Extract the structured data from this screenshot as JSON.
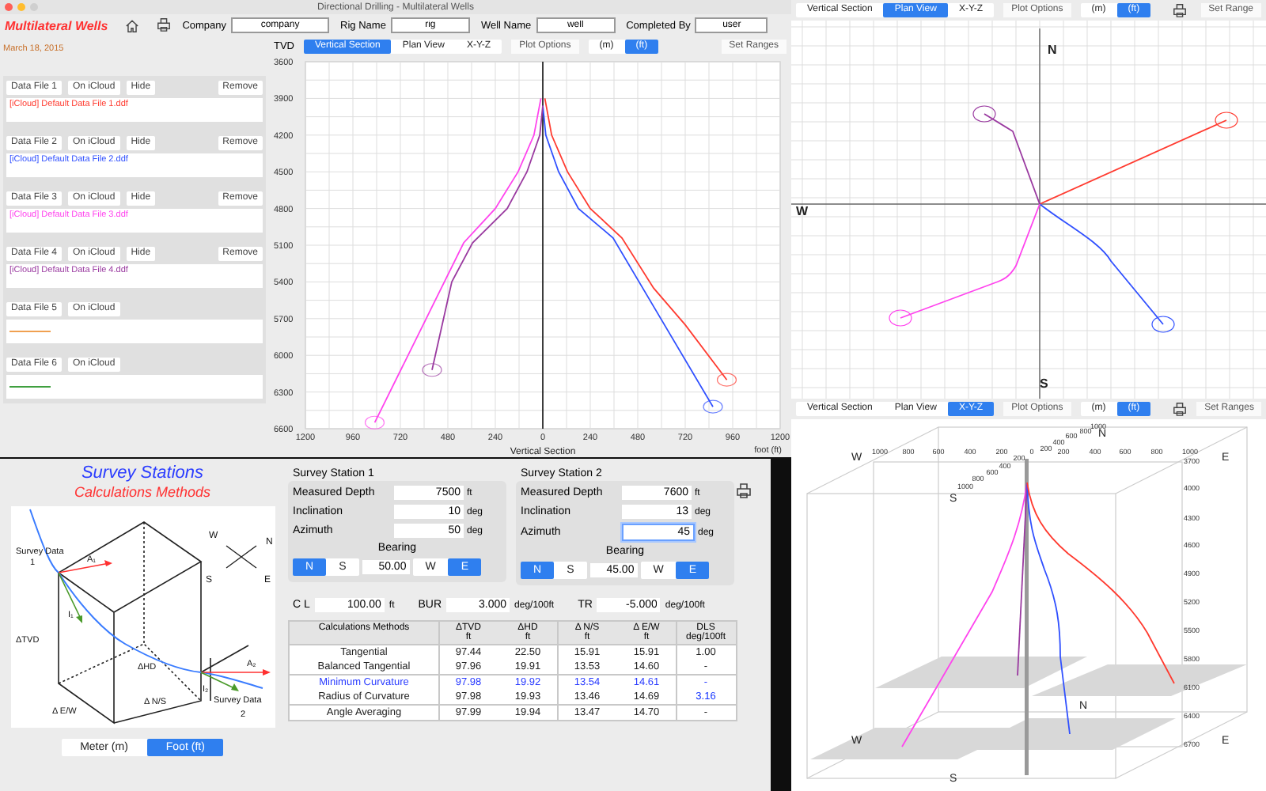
{
  "main_window": {
    "title": "Directional Drilling - Multilateral Wells",
    "app_title": "Multilateral Wells",
    "date": "March 18, 2015",
    "fields": [
      {
        "label": "Company",
        "value": "company"
      },
      {
        "label": "Rig Name",
        "value": "rig"
      },
      {
        "label": "Well Name",
        "value": "well"
      },
      {
        "label": "Completed By",
        "value": "user"
      }
    ],
    "data_files": [
      {
        "kind": "file",
        "label": "Data File 1",
        "icloud": "On iCloud",
        "hide": "Hide",
        "remove": "Remove",
        "file": "[iCloud] Default Data File 1.ddf",
        "color": "#ff3b30"
      },
      {
        "kind": "file",
        "label": "Data File 2",
        "icloud": "On iCloud",
        "hide": "Hide",
        "remove": "Remove",
        "file": "[iCloud] Default Data File 2.ddf",
        "color": "#3050ff"
      },
      {
        "kind": "file",
        "label": "Data File 3",
        "icloud": "On iCloud",
        "hide": "Hide",
        "remove": "Remove",
        "file": "[iCloud] Default Data File 3.ddf",
        "color": "#ff44ee"
      },
      {
        "kind": "file",
        "label": "Data File 4",
        "icloud": "On iCloud",
        "hide": "Hide",
        "remove": "Remove",
        "file": "[iCloud] Default Data File 4.ddf",
        "color": "#9a3aa0"
      },
      {
        "kind": "line",
        "label": "Data File 5",
        "icloud": "On iCloud",
        "color": "#f0a050"
      },
      {
        "kind": "line",
        "label": "Data File 6",
        "icloud": "On iCloud",
        "color": "#40a040"
      }
    ],
    "toolbar": {
      "tabs": [
        {
          "label": "Vertical Section",
          "selected": true
        },
        {
          "label": "Plan View",
          "selected": false
        },
        {
          "label": "X-Y-Z",
          "selected": false
        }
      ],
      "plot_options": "Plot Options",
      "units": [
        {
          "label": "(m)",
          "selected": false
        },
        {
          "label": "(ft)",
          "selected": true
        }
      ],
      "set_ranges": "Set Ranges"
    },
    "unit_label": "foot (ft)",
    "chart_data": {
      "type": "line",
      "grid": true,
      "xlabel": "Vertical Section",
      "ylabel": "TVD",
      "xlim": [
        -1200,
        1200
      ],
      "ylim": [
        6600,
        3600
      ],
      "xticks": [
        {
          "value": -1200,
          "label": "1200"
        },
        {
          "value": -960,
          "label": "960"
        },
        {
          "value": -720,
          "label": "720"
        },
        {
          "value": -480,
          "label": "480"
        },
        {
          "value": -240,
          "label": "240"
        },
        0,
        240,
        480,
        720,
        960,
        1200
      ],
      "yticks": [
        3600,
        3900,
        4200,
        4500,
        4800,
        5100,
        5400,
        5700,
        6000,
        6300,
        6600
      ],
      "series": [
        {
          "color": "#ff3b30",
          "x": [
            10,
            45,
            125,
            240,
            400,
            560,
            720,
            930
          ],
          "values": [
            3900,
            4200,
            4500,
            4800,
            5040,
            5450,
            5750,
            6200
          ]
        },
        {
          "color": "#3050ff",
          "x": [
            0,
            15,
            80,
            180,
            355,
            560,
            860
          ],
          "values": [
            3960,
            4200,
            4500,
            4800,
            5040,
            5600,
            6420
          ]
        },
        {
          "color": "#ff44ee",
          "x": [
            -10,
            -45,
            -125,
            -240,
            -400,
            -850
          ],
          "values": [
            3900,
            4200,
            4500,
            4800,
            5080,
            6550
          ]
        },
        {
          "color": "#9a3aa0",
          "x": [
            0,
            -15,
            -80,
            -180,
            -355,
            -460,
            -560
          ],
          "values": [
            3960,
            4200,
            4500,
            4800,
            5080,
            5400,
            6120
          ]
        }
      ]
    }
  },
  "plan_window": {
    "toolbar": {
      "tabs": [
        {
          "label": "Vertical Section",
          "selected": false
        },
        {
          "label": "Plan View",
          "selected": true
        },
        {
          "label": "X-Y-Z",
          "selected": false
        }
      ],
      "plot_options": "Plot Options",
      "units": [
        {
          "label": "(m)",
          "selected": false
        },
        {
          "label": "(ft)",
          "selected": true
        }
      ],
      "set_ranges": "Set Range"
    },
    "compass": [
      "N",
      "W",
      "S"
    ]
  },
  "xyz_window": {
    "toolbar": {
      "tabs": [
        {
          "label": "Vertical Section",
          "selected": false
        },
        {
          "label": "Plan View",
          "selected": false
        },
        {
          "label": "X-Y-Z",
          "selected": true
        }
      ],
      "plot_options": "Plot Options",
      "units": [
        {
          "label": "(m)",
          "selected": false
        },
        {
          "label": "(ft)",
          "selected": true
        }
      ],
      "set_ranges": "Set Ranges"
    },
    "top_labels": [
      "1000",
      "800",
      "600",
      "400",
      "200",
      "0",
      "200",
      "400",
      "600",
      "800",
      "1000"
    ],
    "near_labels": [
      "200",
      "400",
      "600",
      "800",
      "1000"
    ],
    "far_labels": [
      "200",
      "400",
      "600",
      "800",
      "1000"
    ],
    "depth_labels": [
      "3700",
      "4000",
      "4300",
      "4600",
      "4900",
      "5200",
      "5500",
      "5800",
      "6100",
      "6400",
      "6700"
    ],
    "compass": [
      "W",
      "E",
      "S",
      "N",
      "N",
      "W",
      "E",
      "S"
    ]
  },
  "survey_window": {
    "title": "Survey Stations",
    "subtitle": "Calculations Methods",
    "diagram_labels": [
      "Survey Data",
      "1",
      "A₁",
      "I₁",
      "ΔTVD",
      "ΔHD",
      "Δ E/W",
      "Δ N/S",
      "Survey Data",
      "2",
      "A₂",
      "I₂",
      "W",
      "N",
      "S",
      "E"
    ],
    "units": [
      {
        "label": "Meter (m)",
        "selected": false
      },
      {
        "label": "Foot (ft)",
        "selected": true
      }
    ],
    "stations": [
      {
        "title": "Survey Station 1",
        "rows": [
          {
            "label": "Measured Depth",
            "value": "7500",
            "unit": "ft",
            "focused": false
          },
          {
            "label": "Inclination",
            "value": "10",
            "unit": "deg",
            "focused": false
          },
          {
            "label": "Azimuth",
            "value": "50",
            "unit": "deg",
            "focused": false
          }
        ],
        "bearing_label": "Bearing",
        "ns": [
          {
            "label": "N",
            "selected": true
          },
          {
            "label": "S",
            "selected": false
          }
        ],
        "bearing": "50.00",
        "ew": [
          {
            "label": "W",
            "selected": false
          },
          {
            "label": "E",
            "selected": true
          }
        ]
      },
      {
        "title": "Survey Station 2",
        "rows": [
          {
            "label": "Measured Depth",
            "value": "7600",
            "unit": "ft",
            "focused": false
          },
          {
            "label": "Inclination",
            "value": "13",
            "unit": "deg",
            "focused": false
          },
          {
            "label": "Azimuth",
            "value": "45",
            "unit": "deg",
            "focused": true
          }
        ],
        "bearing_label": "Bearing",
        "ns": [
          {
            "label": "N",
            "selected": true
          },
          {
            "label": "S",
            "selected": false
          }
        ],
        "bearing": "45.00",
        "ew": [
          {
            "label": "W",
            "selected": false
          },
          {
            "label": "E",
            "selected": true
          }
        ]
      }
    ],
    "params": [
      {
        "label": "C L",
        "value": "100.00",
        "unit": "ft"
      },
      {
        "label": "BUR",
        "value": "3.000",
        "unit": "deg/100ft"
      },
      {
        "label": "TR",
        "value": "-5.000",
        "unit": "deg/100ft"
      }
    ],
    "table": {
      "columns": [
        {
          "name": "Calculations Methods"
        },
        {
          "name": "ΔTVD",
          "unit": "ft"
        },
        {
          "name": "ΔHD",
          "unit": "ft"
        },
        {
          "name": "Δ N/S",
          "unit": "ft"
        },
        {
          "name": "Δ E/W",
          "unit": "ft"
        },
        {
          "name": "DLS",
          "unit": "deg/100ft"
        }
      ],
      "rows": [
        {
          "method": "Tangential",
          "values": [
            "97.44",
            "22.50",
            "15.91",
            "15.91",
            "1.00"
          ],
          "selected": false,
          "dls_emphasis": false
        },
        {
          "method": "Balanced Tangential",
          "values": [
            "97.96",
            "19.91",
            "13.53",
            "14.60",
            "-"
          ],
          "selected": false,
          "dls_emphasis": false
        },
        {
          "method": "Minimum Curvature",
          "values": [
            "97.98",
            "19.92",
            "13.54",
            "14.61",
            "-"
          ],
          "selected": true,
          "dls_emphasis": false
        },
        {
          "method": "Radius of Curvature",
          "values": [
            "97.98",
            "19.93",
            "13.46",
            "14.69",
            "3.16"
          ],
          "selected": false,
          "dls_emphasis": true
        },
        {
          "method": "Angle Averaging",
          "values": [
            "97.99",
            "19.94",
            "13.47",
            "14.70",
            "-"
          ],
          "selected": false,
          "dls_emphasis": false
        }
      ]
    }
  }
}
